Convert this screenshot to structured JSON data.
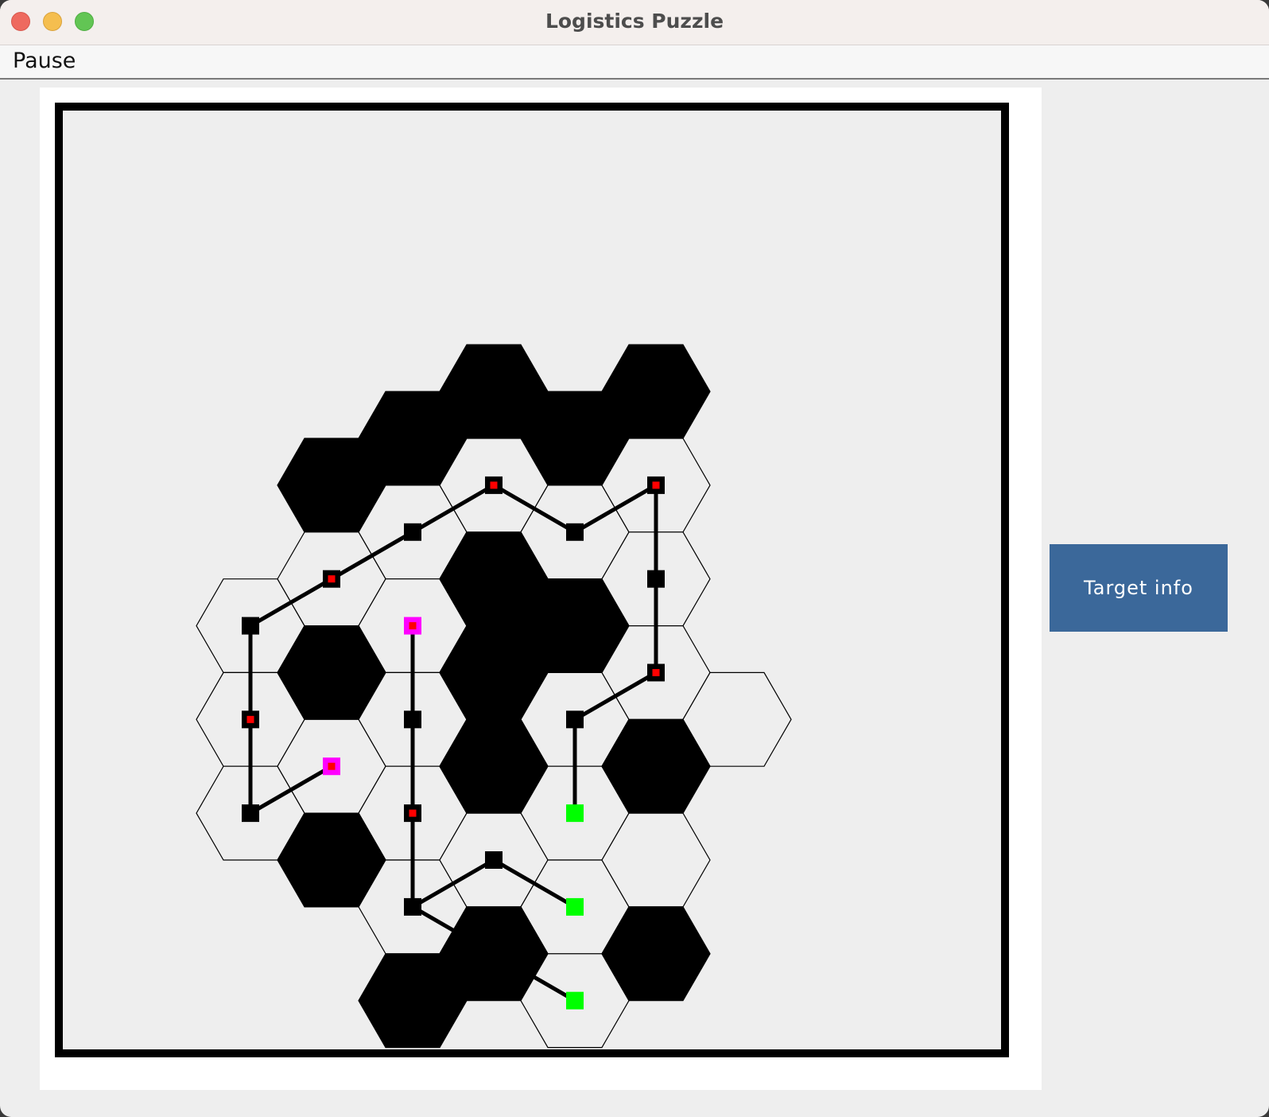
{
  "window": {
    "title": "Logistics Puzzle"
  },
  "menu": {
    "items": [
      {
        "label": "Pause"
      }
    ]
  },
  "side_panel": {
    "target_button_label": "Target info"
  },
  "board": {
    "grid_type": "hexagonal",
    "colors": {
      "background": "#eeeeee",
      "frame": "#000000",
      "wall": "#000000",
      "cell_outline": "#000000",
      "node": "#000000",
      "waypoint_marker": "#ff0000",
      "source": "#ff00ff",
      "target": "#00ff00",
      "track": "#000000"
    },
    "rows": [
      {
        "row": 0,
        "cells": [
          {
            "col": 2,
            "type": "wall"
          },
          {
            "col": 3,
            "type": "wall"
          },
          {
            "col": 4,
            "type": "wall"
          },
          {
            "col": 5,
            "type": "wall"
          }
        ]
      },
      {
        "row": 1,
        "cells": [
          {
            "col": 1,
            "type": "wall"
          },
          {
            "col": 2,
            "type": "open"
          },
          {
            "col": 3,
            "type": "open"
          },
          {
            "col": 4,
            "type": "open"
          },
          {
            "col": 5,
            "type": "open"
          }
        ]
      },
      {
        "row": 2,
        "cells": [
          {
            "col": 0,
            "type": "open"
          },
          {
            "col": 1,
            "type": "open"
          },
          {
            "col": 2,
            "type": "open"
          },
          {
            "col": 3,
            "type": "wall"
          },
          {
            "col": 4,
            "type": "wall"
          },
          {
            "col": 5,
            "type": "open"
          }
        ]
      },
      {
        "row": 3,
        "cells": [
          {
            "col": 0,
            "type": "open"
          },
          {
            "col": 1,
            "type": "wall"
          },
          {
            "col": 2,
            "type": "open"
          },
          {
            "col": 3,
            "type": "wall"
          },
          {
            "col": 4,
            "type": "open"
          },
          {
            "col": 5,
            "type": "open"
          },
          {
            "col": 6,
            "type": "open"
          }
        ]
      },
      {
        "row": 4,
        "cells": [
          {
            "col": 0,
            "type": "open"
          },
          {
            "col": 1,
            "type": "open"
          },
          {
            "col": 2,
            "type": "open"
          },
          {
            "col": 3,
            "type": "wall"
          },
          {
            "col": 4,
            "type": "open"
          },
          {
            "col": 5,
            "type": "wall"
          }
        ]
      },
      {
        "row": 5,
        "cells": [
          {
            "col": 1,
            "type": "wall"
          },
          {
            "col": 2,
            "type": "open"
          },
          {
            "col": 3,
            "type": "open"
          },
          {
            "col": 4,
            "type": "open"
          },
          {
            "col": 5,
            "type": "open"
          }
        ]
      },
      {
        "row": 6,
        "cells": [
          {
            "col": 2,
            "type": "wall"
          },
          {
            "col": 3,
            "type": "wall"
          },
          {
            "col": 4,
            "type": "open"
          },
          {
            "col": 5,
            "type": "wall"
          }
        ]
      }
    ],
    "nodes": [
      {
        "id": "n1",
        "row": 1,
        "col": 2,
        "kind": "plain"
      },
      {
        "id": "n2",
        "row": 1,
        "col": 3,
        "kind": "waypoint"
      },
      {
        "id": "n3",
        "row": 1,
        "col": 4,
        "kind": "plain"
      },
      {
        "id": "n4",
        "row": 1,
        "col": 5,
        "kind": "waypoint"
      },
      {
        "id": "n5",
        "row": 2,
        "col": 0,
        "kind": "plain"
      },
      {
        "id": "n6",
        "row": 2,
        "col": 1,
        "kind": "waypoint"
      },
      {
        "id": "n7",
        "row": 2,
        "col": 2,
        "kind": "source"
      },
      {
        "id": "n8",
        "row": 2,
        "col": 5,
        "kind": "plain"
      },
      {
        "id": "n9",
        "row": 3,
        "col": 0,
        "kind": "waypoint"
      },
      {
        "id": "n10",
        "row": 3,
        "col": 2,
        "kind": "plain"
      },
      {
        "id": "n11",
        "row": 3,
        "col": 4,
        "kind": "plain"
      },
      {
        "id": "n12",
        "row": 3,
        "col": 5,
        "kind": "waypoint"
      },
      {
        "id": "n13",
        "row": 4,
        "col": 0,
        "kind": "plain"
      },
      {
        "id": "n14",
        "row": 4,
        "col": 1,
        "kind": "source"
      },
      {
        "id": "n15",
        "row": 4,
        "col": 2,
        "kind": "waypoint"
      },
      {
        "id": "n16",
        "row": 4,
        "col": 4,
        "kind": "target"
      },
      {
        "id": "n17",
        "row": 5,
        "col": 2,
        "kind": "plain"
      },
      {
        "id": "n18",
        "row": 5,
        "col": 3,
        "kind": "plain"
      },
      {
        "id": "n19",
        "row": 5,
        "col": 4,
        "kind": "target"
      },
      {
        "id": "n20",
        "row": 6,
        "col": 4,
        "kind": "target"
      }
    ],
    "tracks": [
      [
        "n1",
        "n2"
      ],
      [
        "n2",
        "n3"
      ],
      [
        "n3",
        "n4"
      ],
      [
        "n4",
        "n8"
      ],
      [
        "n8",
        "n12"
      ],
      [
        "n12",
        "n11"
      ],
      [
        "n11",
        "n16"
      ],
      [
        "n1",
        "n6"
      ],
      [
        "n6",
        "n5"
      ],
      [
        "n5",
        "n9"
      ],
      [
        "n9",
        "n13"
      ],
      [
        "n13",
        "n14"
      ],
      [
        "n7",
        "n10"
      ],
      [
        "n10",
        "n15"
      ],
      [
        "n15",
        "n17"
      ],
      [
        "n17",
        "n18"
      ],
      [
        "n18",
        "n19"
      ],
      [
        "n17",
        "n20"
      ]
    ]
  }
}
